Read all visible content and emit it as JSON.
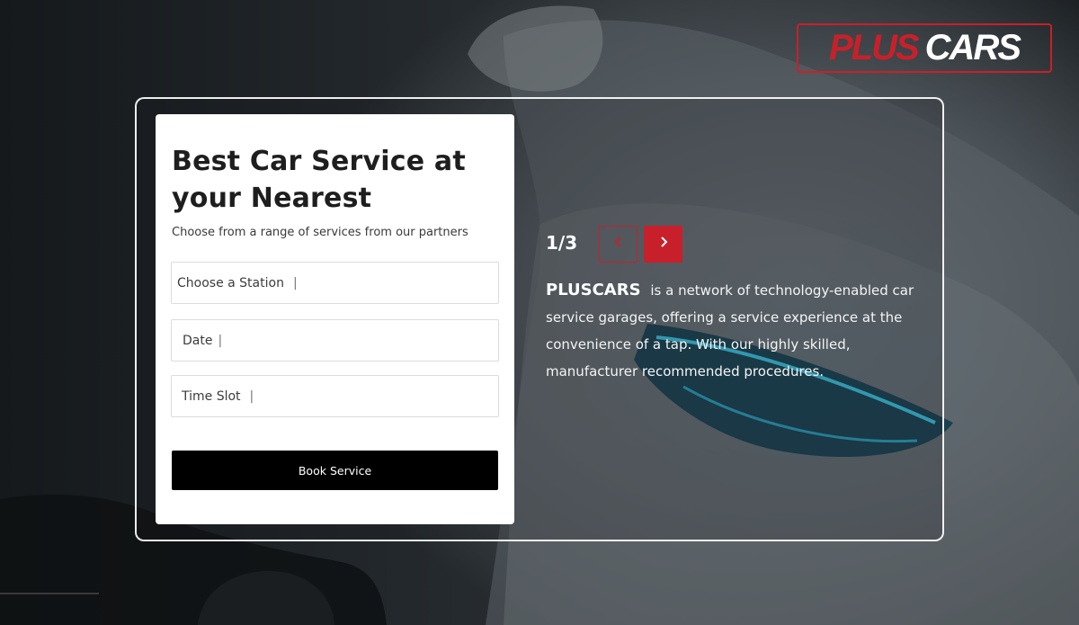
{
  "brand": {
    "logo_part1": "PLUS",
    "logo_part2": "CARS",
    "accent_color": "#c8202a"
  },
  "booking": {
    "title": "Best Car Service at your Nearest",
    "subtitle": "Choose from a range of services from our partners",
    "fields": [
      {
        "label": "Choose a Station",
        "caret": "|"
      },
      {
        "label": "Date",
        "caret": "|"
      },
      {
        "label": "Time Slot",
        "caret": "|"
      }
    ],
    "submit_label": "Book Service"
  },
  "slider": {
    "counter": "1/3",
    "prev_icon": "chevron-left-icon",
    "next_icon": "chevron-right-icon",
    "brand_word": "PLUSCARS",
    "description": "is a network of technology-enabled car service garages, offering a service experience at the convenience of a tap. With our highly skilled, manufacturer recommended procedures."
  }
}
